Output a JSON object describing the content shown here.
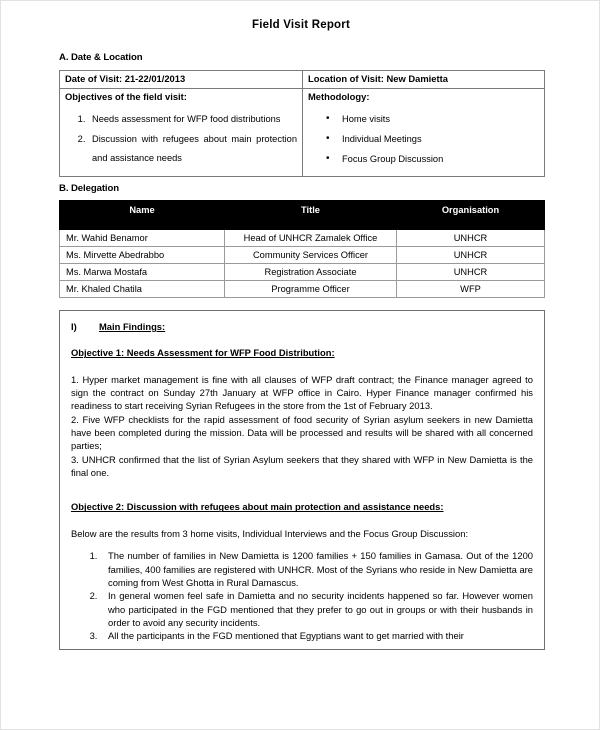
{
  "document": {
    "title": "Field Visit Report"
  },
  "section_a": {
    "heading": "A. Date & Location",
    "date_of_visit": "Date of Visit: 21-22/01/2013",
    "location_of_visit": "Location of Visit: New Damietta",
    "objectives_label": "Objectives of the field visit:",
    "methodology_label": "Methodology:",
    "objectives": [
      "Needs assessment for WFP food distributions",
      "Discussion with refugees about main protection and assistance needs"
    ],
    "methodology": [
      "Home visits",
      "Individual Meetings",
      "Focus Group Discussion"
    ]
  },
  "section_b": {
    "heading": "B. Delegation",
    "columns": [
      "Name",
      "Title",
      "Organisation"
    ],
    "rows": [
      [
        "Mr. Wahid Benamor",
        "Head of UNHCR Zamalek Office",
        "UNHCR"
      ],
      [
        "Ms. Mirvette Abedrabbo",
        "Community Services Officer",
        "UNHCR"
      ],
      [
        "Ms. Marwa Mostafa",
        "Registration Associate",
        "UNHCR"
      ],
      [
        "Mr. Khaled Chatila",
        "Programme Officer",
        "WFP"
      ]
    ]
  },
  "findings": {
    "roman": "I)",
    "heading": "Main Findings:",
    "objective1_heading": "Objective 1: Needs Assessment for WFP Food Distribution:",
    "objective1_paragraphs": [
      "1. Hyper market management is fine with all clauses of WFP draft contract; the Finance manager agreed to sign the contract on Sunday 27th January at WFP office in Cairo. Hyper Finance manager confirmed his readiness to start receiving Syrian Refugees in the store from the 1st of February 2013.",
      "2. Five WFP checklists for the rapid assessment of food security of Syrian asylum seekers in new Damietta have been completed during the mission. Data will be processed and results will be shared with all concerned parties;",
      "3. UNHCR confirmed that the list of Syrian Asylum seekers that they shared with WFP in New Damietta is the final one."
    ],
    "objective2_heading": "Objective 2: Discussion with refugees about main protection and assistance needs:",
    "objective2_lead": "Below are the results from 3 home visits, Individual Interviews and the Focus Group Discussion:",
    "objective2_items": [
      "The number of families in New Damietta is 1200 families + 150 families in Gamasa. Out of the 1200 families, 400 families are registered with UNHCR. Most of the Syrians who reside in New Damietta are coming from West Ghotta in Rural Damascus.",
      "In general women feel safe in Damietta and no security incidents happened so far. However women who participated in the FGD mentioned that they prefer to go out in groups or with their husbands in order to avoid any security incidents.",
      "All the participants in the FGD mentioned that Egyptians want to get married with their"
    ]
  }
}
